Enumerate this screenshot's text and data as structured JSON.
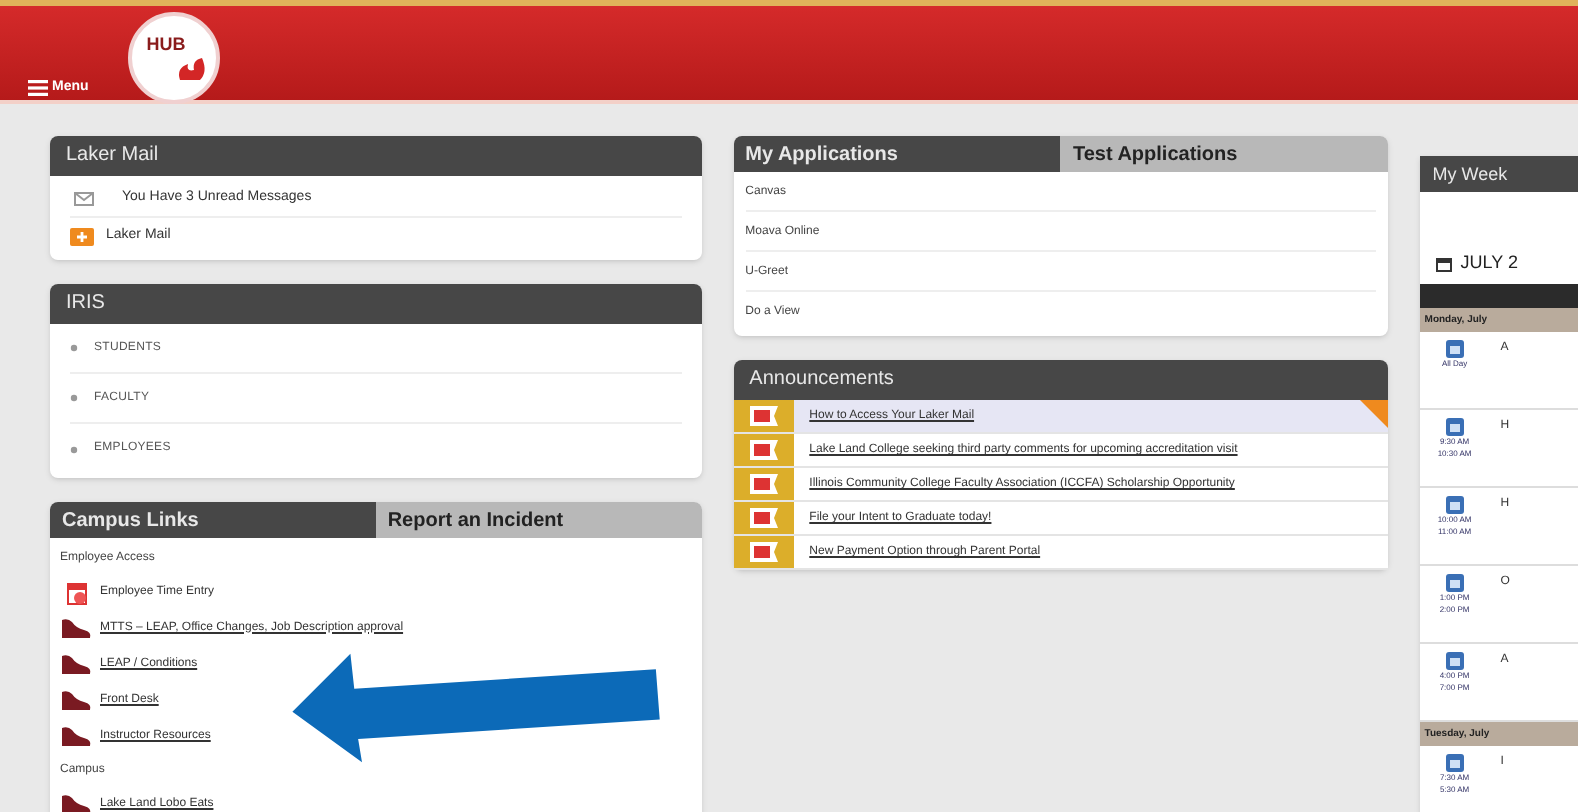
{
  "header": {
    "menu_label": "Menu",
    "logo_text": "HUB"
  },
  "laker_mail": {
    "title": "Laker Mail",
    "items": [
      {
        "kind": "message",
        "label": "You Have 3 Unread Messages"
      },
      {
        "kind": "link",
        "label": "Laker Mail"
      }
    ]
  },
  "iris": {
    "title": "IRIS",
    "items": [
      "STUDENTS",
      "FACULTY",
      "EMPLOYEES"
    ]
  },
  "campus_links": {
    "tabs": [
      {
        "label": "Campus Links",
        "selected": true
      },
      {
        "label": "Report an Incident",
        "selected": false
      }
    ],
    "sections": [
      {
        "heading": "Employee Access",
        "links": [
          {
            "kind": "time",
            "label": "Employee Time Entry"
          },
          {
            "kind": "shoe",
            "label": "MTTS – LEAP, Office Changes, Job Description approval"
          },
          {
            "kind": "shoe",
            "label": "LEAP / Conditions"
          },
          {
            "kind": "shoe",
            "label": "Front Desk"
          },
          {
            "kind": "shoe",
            "label": "Instructor Resources"
          }
        ]
      },
      {
        "heading": "Campus",
        "links": [
          {
            "kind": "shoe",
            "label": "Lake Land Lobo Eats"
          }
        ]
      }
    ]
  },
  "applications": {
    "tabs": [
      {
        "label": "My Applications",
        "selected": true
      },
      {
        "label": "Test Applications",
        "selected": false
      }
    ],
    "items": [
      "Canvas",
      "Moava Online",
      "U-Greet",
      "Do a View"
    ]
  },
  "announcements": {
    "title": "Announcements",
    "items": [
      {
        "label": "How to Access Your Laker Mail",
        "selected": true
      },
      {
        "label": "Lake Land College seeking third party comments for upcoming accreditation visit",
        "selected": false
      },
      {
        "label": "Illinois Community College Faculty Association (ICCFA) Scholarship Opportunity",
        "selected": false
      },
      {
        "label": "File your Intent to Graduate today!",
        "selected": false
      },
      {
        "label": "New Payment Option through Parent Portal",
        "selected": false
      }
    ]
  },
  "my_week": {
    "title": "My Week",
    "month": "JULY 2",
    "days": [
      {
        "label": "Monday, July",
        "events": [
          {
            "times": [
              "All Day"
            ],
            "title": "A"
          },
          {
            "times": [
              "9:30 AM",
              "10:30 AM"
            ],
            "title": "H"
          },
          {
            "times": [
              "10:00 AM",
              "11:00 AM"
            ],
            "title": "H"
          },
          {
            "times": [
              "1:00 PM",
              "2:00 PM"
            ],
            "title": "O"
          },
          {
            "times": [
              "4:00 PM",
              "7:00 PM"
            ],
            "title": "A"
          }
        ]
      },
      {
        "label": "Tuesday, July",
        "events": [
          {
            "times": [
              "7:30 AM",
              "5:30 AM"
            ],
            "title": "I"
          }
        ]
      }
    ]
  }
}
